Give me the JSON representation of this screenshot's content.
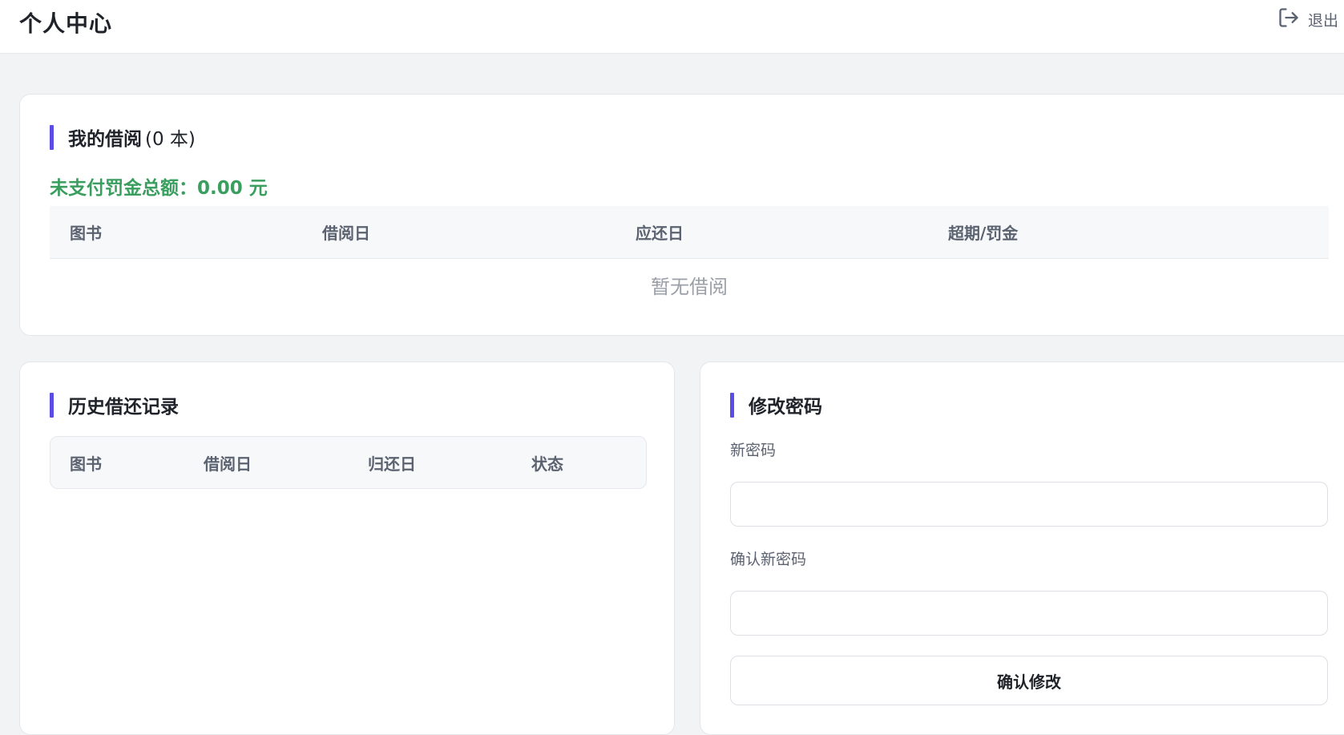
{
  "header": {
    "title": "个人中心",
    "logout_label": "退出",
    "logout_icon": "logout-icon"
  },
  "borrowing": {
    "title": "我的借阅",
    "count_text": "(0 本)",
    "fine_text": "未支付罚金总额：0.00 元",
    "columns": [
      "图书",
      "借阅日",
      "应还日",
      "超期/罚金"
    ],
    "empty_text": "暂无借阅"
  },
  "history": {
    "title": "历史借还记录",
    "columns": [
      "图书",
      "借阅日",
      "归还日",
      "状态"
    ]
  },
  "password": {
    "title": "修改密码",
    "new_label": "新密码",
    "confirm_label": "确认新密码",
    "new_value": "",
    "confirm_value": "",
    "submit_label": "确认修改"
  },
  "colors": {
    "accent": "#5b4ce6",
    "fine_green": "#3a9e5f",
    "background": "#f2f3f5"
  }
}
